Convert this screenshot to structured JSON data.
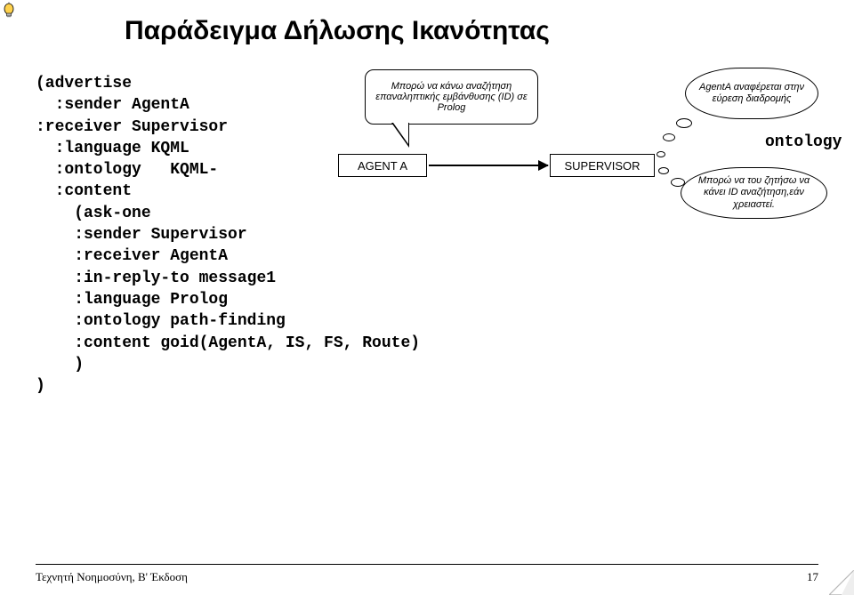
{
  "title": "Παράδειγμα Δήλωσης Ικανότητας",
  "code": {
    "l1": "(advertise",
    "l2": "  :sender AgentA",
    "l3": ":receiver Supervisor",
    "l4": "  :language KQML",
    "l5": "  :ontology   KQML-",
    "l6": "  :content",
    "l7": "    (ask-one",
    "l8": "    :sender Supervisor",
    "l9": "    :receiver AgentA",
    "l10": "    :in-reply-to message1",
    "l11": "    :language Prolog",
    "l12": "    :ontology path-finding",
    "l13": "    :content goid(AgentA, IS, FS, Route)",
    "l14": "    )",
    "l15": ")"
  },
  "diagram": {
    "speech": "Μπορώ να κάνω αναζήτηση επαναληπτικής εμβάνθυσης (ID) σε Prolog",
    "agent_box": "AGENT A",
    "supervisor_box": "SUPERVISOR",
    "thought_top": "AgentA αναφέρεται στην εύρεση διαδρομής",
    "thought_bottom": "Μπορώ να του ζητήσω να κάνει ID αναζήτηση,εάν χρειαστεί.",
    "ontology_label": "ontology"
  },
  "footer": {
    "left": "Τεχνητή Νοημοσύνη, B' Έκδοση",
    "right": "17"
  }
}
